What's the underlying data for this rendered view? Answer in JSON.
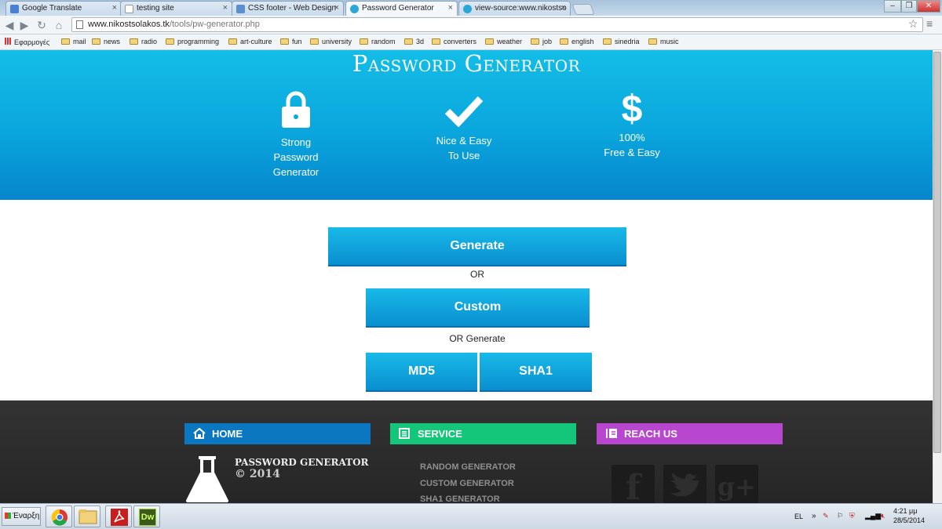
{
  "browser": {
    "tabs": [
      {
        "label": "Google Translate",
        "color": "#4a7fd6"
      },
      {
        "label": "testing site",
        "color": "#cfd8e2"
      },
      {
        "label": "CSS footer - Web Design",
        "color": "#5a8fd1"
      },
      {
        "label": "Password Generator",
        "color": "#2aa6d8"
      },
      {
        "label": "view-source:www.nikostso",
        "color": "#2aa6d8"
      }
    ],
    "url_domain": "www.nikostsolakos.tk",
    "url_path": "/tools/pw-generator.php",
    "bookmarks": [
      "Εφαρμογές",
      "mail",
      "news",
      "radio",
      "programming",
      "art-culture",
      "fun",
      "university",
      "random",
      "3d",
      "converters",
      "weather",
      "job",
      "english",
      "sinedria",
      "music"
    ]
  },
  "hero": {
    "title": "Password Generator",
    "features": [
      {
        "icon": "lock-icon",
        "line1": "Strong",
        "line2": "Password",
        "line3": "Generator"
      },
      {
        "icon": "checkmark-icon",
        "line1": "Nice & Easy",
        "line2": "To Use"
      },
      {
        "icon": "dollar-icon",
        "line1": "100%",
        "line2": "Free & Easy"
      }
    ]
  },
  "main": {
    "generate_label": "Generate",
    "or_label": "OR",
    "custom_label": "Custom",
    "or_generate_label": "OR Generate",
    "md5_label": "MD5",
    "sha1_label": "SHA1"
  },
  "footer": {
    "home_label": "HOME",
    "service_label": "SERVICE",
    "reach_label": "REACH US",
    "brand_name": "PASSWORD GENERATOR",
    "copyright": "© 2014",
    "service_links": [
      "RANDOM GENERATOR",
      "CUSTOM GENERATOR",
      "SHA1 GENERATOR"
    ],
    "social": [
      "f",
      "g+"
    ],
    "colors": {
      "home": "#0a77c0",
      "service": "#13c679",
      "reach": "#b946cf"
    }
  },
  "taskbar": {
    "start_label": "Έναρξη",
    "language": "EL",
    "time": "4:21 μμ",
    "date": "28/5/2014"
  }
}
